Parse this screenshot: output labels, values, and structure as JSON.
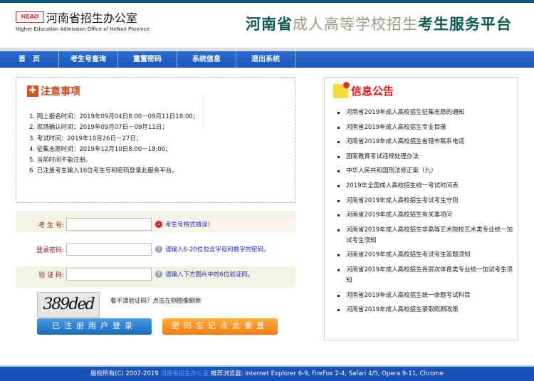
{
  "header": {
    "logo_mark": "HEAO",
    "logo_cn": "河南省招生办公室",
    "logo_en": "Higher Education Admission Office of HeNan Province",
    "title_a": "河南省",
    "title_b": "成人高等学校招生",
    "title_c": "考生服务平台"
  },
  "nav": [
    "首　页",
    "考生号查询",
    "重置密码",
    "系统信息",
    "退出系统"
  ],
  "notice": {
    "title": "注意事项",
    "items": [
      "1.  网上报名时间：2019年09月04日8:00－09月11日18:00；",
      "2.  现场确认时间：2019年09月07日－09月11日；",
      "3.  考试时间：2019年10月26日－27日；",
      "4.  征集志愿时间：2019年12月10日8:00－18:00；",
      "5.  当前时间不能注册。",
      "6.  已注册考生输入16位考生号和密码登录此服务平台。"
    ]
  },
  "form": {
    "exam_no_label": "考 生 号:",
    "exam_no_msg": "考生号格式错误！",
    "password_label": "登录密码:",
    "password_msg": "请输入6-20位包含字母和数字的密码。",
    "captcha_label": "验 证 码:",
    "captcha_msg": "请输入下方图片中的6位验证码。",
    "captcha_text": "389ded",
    "captcha_hint": "看不清验证码？点击左侧图像刷新",
    "login_button": "已注册用户登录",
    "reset_button": "密码忘记点此重置"
  },
  "news": {
    "title": "信息公告",
    "items": [
      "河南省2019年成人高校招生征集志愿的通知",
      "河南省2019年成人高校招生专业目录",
      "河南省2019年成人高校招生省辖市联系电话",
      "国家教育考试违规处理办法",
      "中华人民共和国刑法修正案（九）",
      "2019年全国成人高校招生统一考试时间表",
      "河南省2019年成人高校招生考试考生守则",
      "河南省2019年成人高校招生有关事项问",
      "河南省2019年成人高校招生非高等艺术院校艺术类专业统一加试考生须知",
      "河南省2019年成人高校招生考试考生答题须知",
      "河南省2019年成人高校招生各层次体育类专业统一加试考生须知",
      "河南省2019年成人高校招生统一命题考试科目",
      "河南省2019年成人高校招生录取照顾政策"
    ]
  },
  "footer": {
    "copyright": "版权所有(C) 2007-2019 ",
    "org": "河南省招生办公室",
    "browsers": "  推荐浏览器: Internet Explorer 6-9, FireFox 2-4, Safari 4/5, Opera 9-11, Chrome"
  },
  "colors": {
    "nav": "#1a55b8",
    "title": "#0d5a55",
    "notice_title": "#c8461a",
    "news_title": "#e01a1a",
    "footer": "#1a50b8"
  }
}
